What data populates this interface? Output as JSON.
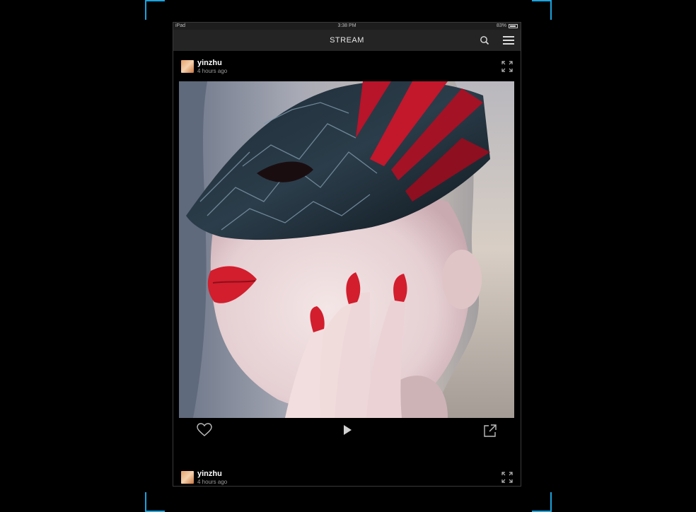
{
  "status_bar": {
    "device": "iPad",
    "time": "3:38 PM",
    "battery": "83%"
  },
  "nav": {
    "title": "STREAM"
  },
  "posts": [
    {
      "username": "yinzhu",
      "time": "4 hours ago"
    },
    {
      "username": "yinzhu",
      "time": "4 hours ago"
    }
  ],
  "icons": {
    "search": "search-icon",
    "menu": "hamburger-menu-icon",
    "expand": "expand-icon",
    "like": "heart-icon",
    "play": "play-icon",
    "share": "share-icon"
  },
  "colors": {
    "accent_bracket": "#1aa3e0",
    "nav_bg": "#242424",
    "lipstick_red": "#d21e2d"
  }
}
